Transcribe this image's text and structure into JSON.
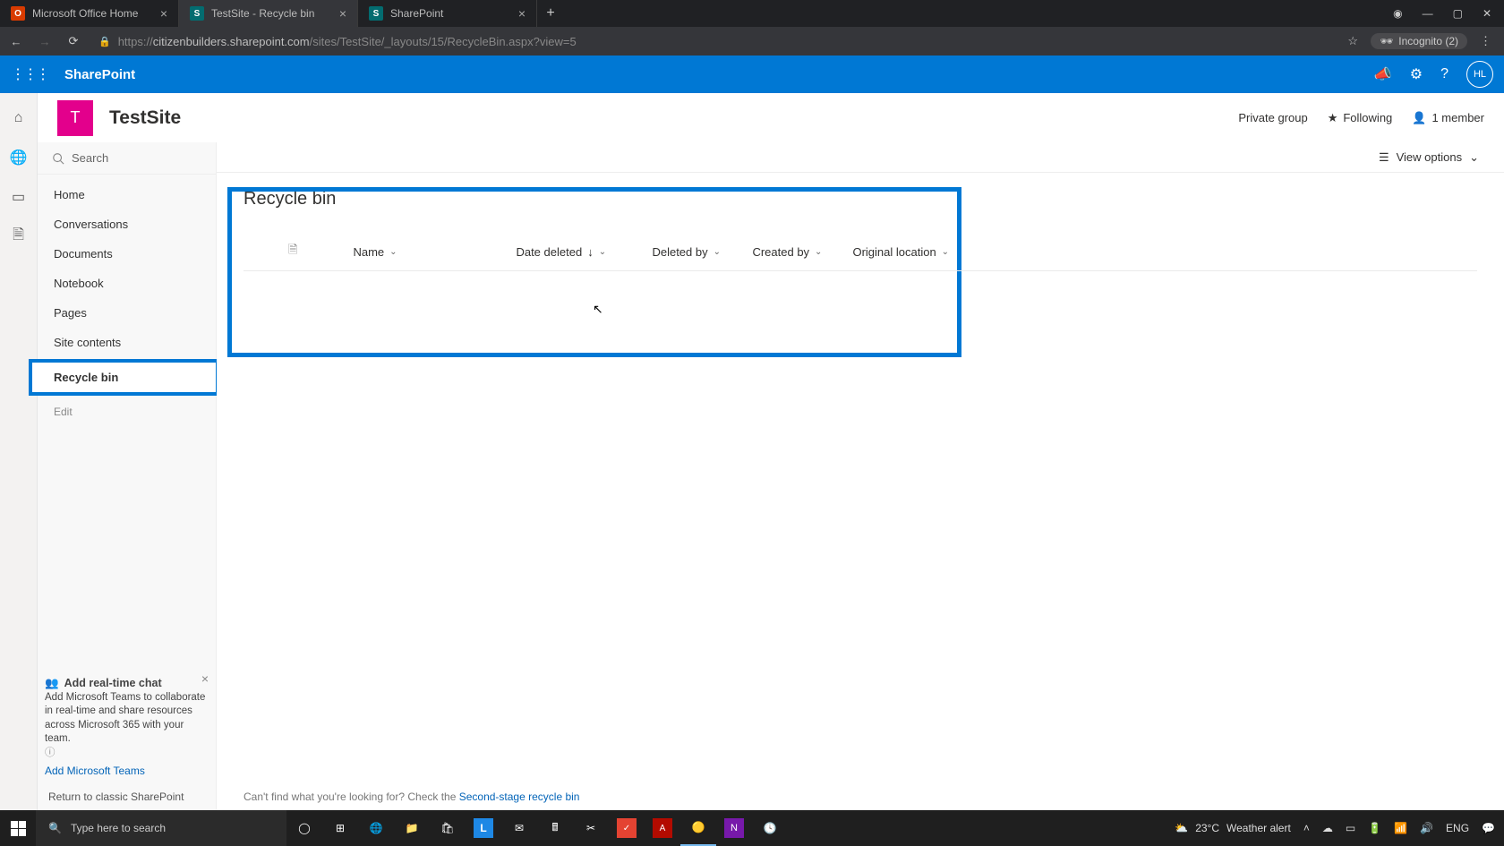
{
  "browser": {
    "tabs": [
      {
        "title": "Microsoft Office Home",
        "active": false
      },
      {
        "title": "TestSite - Recycle bin",
        "active": true
      },
      {
        "title": "SharePoint",
        "active": false
      }
    ],
    "url_prefix": "https://",
    "url_host": "citizenbuilders.sharepoint.com",
    "url_path": "/sites/TestSite/_layouts/15/RecycleBin.aspx?view=5",
    "incognito_label": "Incognito (2)"
  },
  "suite": {
    "brand": "SharePoint",
    "avatar": "HL"
  },
  "site": {
    "tile_letter": "T",
    "name": "TestSite",
    "group_label": "Private group",
    "following_label": "Following",
    "members_label": "1 member"
  },
  "leftnav": {
    "search_placeholder": "Search",
    "items": [
      {
        "label": "Home"
      },
      {
        "label": "Conversations"
      },
      {
        "label": "Documents"
      },
      {
        "label": "Notebook"
      },
      {
        "label": "Pages"
      },
      {
        "label": "Site contents"
      },
      {
        "label": "Recycle bin"
      }
    ],
    "edit_label": "Edit",
    "classic_link": "Return to classic SharePoint"
  },
  "promo": {
    "title": "Add real-time chat",
    "body": "Add Microsoft Teams to collaborate in real-time and share resources across Microsoft 365 with your team.",
    "link": "Add Microsoft Teams"
  },
  "viewopts": {
    "label": "View options"
  },
  "recyclebin": {
    "title": "Recycle bin",
    "columns": {
      "name": "Name",
      "date_deleted": "Date deleted",
      "deleted_by": "Deleted by",
      "created_by": "Created by",
      "original_location": "Original location"
    },
    "footer_prefix": "Can't find what you're looking for? Check the ",
    "footer_link": "Second-stage recycle bin"
  },
  "taskbar": {
    "search_placeholder": "Type here to search",
    "weather_temp": "23°C",
    "weather_label": "Weather alert",
    "lang": "ENG"
  }
}
